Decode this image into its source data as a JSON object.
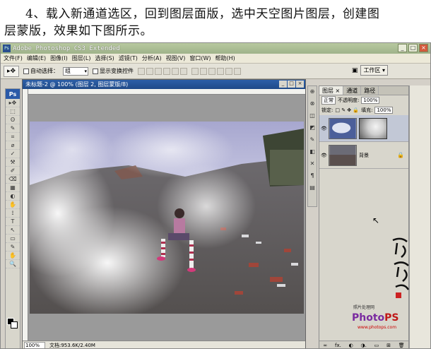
{
  "caption": {
    "line1": "4、载入新通道选区，回到图层面版，选中天空图片图层，创建图",
    "line2": "层蒙版，效果如下图所示。"
  },
  "window": {
    "title": "Adobe Photoshop CS3 Extended",
    "buttons": [
      "_",
      "□",
      "×"
    ]
  },
  "menu": [
    "文件(F)",
    "编辑(E)",
    "图像(I)",
    "图层(L)",
    "选择(S)",
    "滤镜(T)",
    "分析(A)",
    "视图(V)",
    "窗口(W)",
    "帮助(H)"
  ],
  "options": {
    "auto_select_label": "自动选择：",
    "auto_select_value": "组",
    "show_transform_label": "显示变换控件",
    "workspace_label": "工作区 ▾"
  },
  "toolbox": {
    "logo": "Ps",
    "tools": [
      "▸✥",
      "⬚",
      "ʘ",
      "✎",
      "⌗",
      "⌀",
      "✓",
      "⚒",
      "✐",
      "⌫",
      "▦",
      "◐",
      "✋",
      "⟟",
      "T",
      "↖",
      "▭",
      "✎",
      "✋",
      "🔍"
    ]
  },
  "document": {
    "title": "未标题-2 @ 100% (图层 2, 图层蒙版/8)",
    "zoom": "100%",
    "doc_size": "文档:953.6K/2.40M"
  },
  "dock_icons": [
    "⊕",
    "⊗",
    "◫",
    "◩",
    "✎",
    "◧",
    "✕",
    "¶",
    "▤"
  ],
  "layers_panel": {
    "tabs": [
      "图层 ×",
      "通道",
      "路径"
    ],
    "blend_mode": "正常",
    "opacity_label": "不透明度:",
    "opacity_value": "100%",
    "lock_label": "锁定:",
    "fill_label": "填充:",
    "fill_value": "100%",
    "layers": [
      {
        "name": "",
        "selected": true,
        "has_mask": true
      },
      {
        "name": "背景",
        "selected": false,
        "has_mask": false,
        "lock": "🔒"
      }
    ],
    "bottom_icons": [
      "∞",
      "fx.",
      "◐",
      "◑.",
      "▭",
      "⊞",
      "🗑"
    ]
  },
  "watermark": {
    "top": "照片处理网",
    "logo_photo": "Photo",
    "logo_ps": "PS",
    "url": "www.photops.com"
  },
  "colors": {
    "titlebar": "#9fb38a",
    "doc_title": "#1f4a88",
    "ps_blue": "#2b5aa8"
  }
}
